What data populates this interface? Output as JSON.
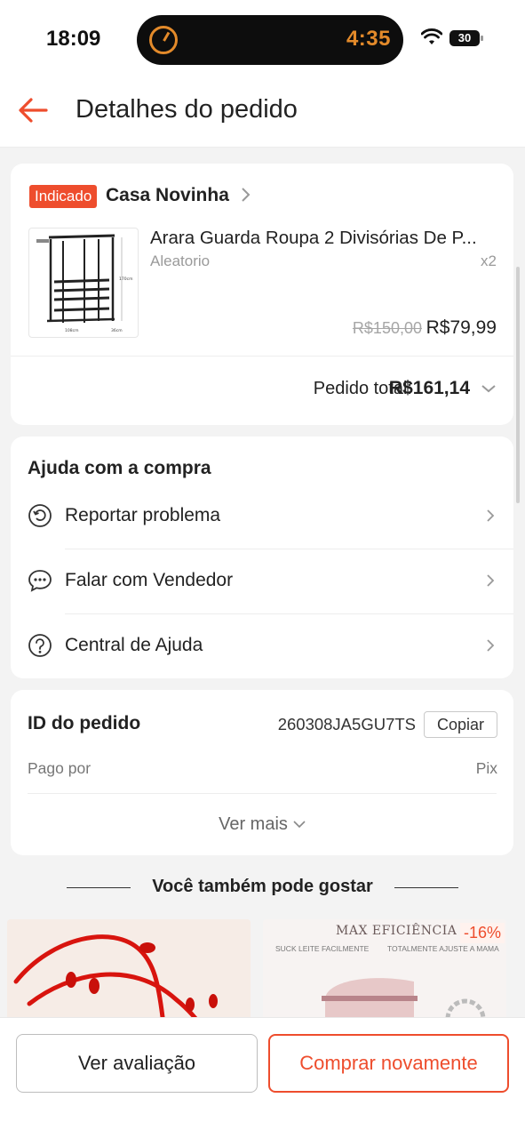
{
  "status_bar": {
    "time": "18:09",
    "timer": "4:35",
    "battery": "30"
  },
  "header": {
    "title": "Detalhes do pedido"
  },
  "order": {
    "badge": "Indicado",
    "shop_name": "Casa Novinha",
    "product": {
      "name": "Arara Guarda Roupa 2 Divisórias De P...",
      "variant": "Aleatorio",
      "quantity": "x2",
      "price_original": "R$150,00",
      "price": "R$79,99",
      "image_labels": {
        "height": "170cm",
        "width": "108cm",
        "depth": "36cm"
      }
    },
    "total_label": "Pedido total:",
    "total_value": "R$161,14"
  },
  "help": {
    "title": "Ajuda com a compra",
    "items": [
      {
        "label": "Reportar problema",
        "icon": "report-icon"
      },
      {
        "label": "Falar com Vendedor",
        "icon": "chat-icon"
      },
      {
        "label": "Central de Ajuda",
        "icon": "help-icon"
      }
    ]
  },
  "order_info": {
    "id_label": "ID do pedido",
    "id_value": "260308JA5GU7TS",
    "copy_label": "Copiar",
    "paid_label": "Pago por",
    "paid_value": "Pix",
    "see_more": "Ver mais"
  },
  "recommendations": {
    "title": "Você também pode gostar",
    "items": [
      {
        "image": "red-bracelet"
      },
      {
        "headline": "MAX EFICIÊNCIA",
        "discount": "-16%",
        "tag_left": "SUCK LEITE FACILMENTE",
        "tag_right": "TOTALMENTE AJUSTE A MAMA"
      }
    ]
  },
  "actions": {
    "review": "Ver avaliação",
    "buy_again": "Comprar novamente"
  },
  "colors": {
    "accent": "#ee4d2d",
    "timer": "#e38a2a"
  }
}
